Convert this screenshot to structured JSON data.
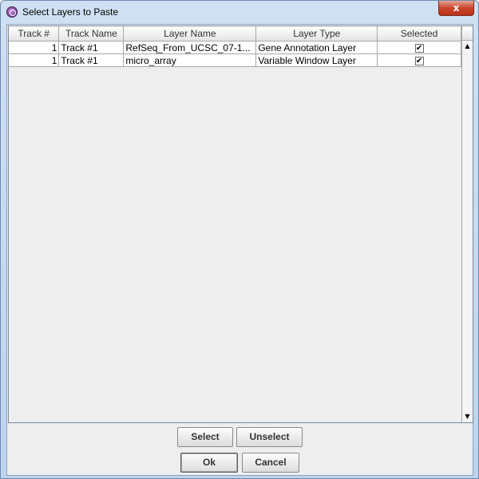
{
  "window": {
    "title": "Select Layers to Paste",
    "close_label": "x"
  },
  "table": {
    "columns": [
      "Track #",
      "Track Name",
      "Layer Name",
      "Layer Type",
      "Selected"
    ],
    "rows": [
      {
        "track_num": "1",
        "track_name": "Track #1",
        "layer_name": "RefSeq_From_UCSC_07-1...",
        "layer_type": "Gene Annotation Layer",
        "selected": "✔"
      },
      {
        "track_num": "1",
        "track_name": "Track #1",
        "layer_name": "micro_array",
        "layer_type": "Variable Window Layer",
        "selected": "✔"
      }
    ]
  },
  "scrollbar": {
    "up_arrow": "▲",
    "down_arrow": "▼"
  },
  "buttons": {
    "select": "Select",
    "unselect": "Unselect",
    "ok": "Ok",
    "cancel": "Cancel"
  },
  "icons": {
    "app": "app-icon",
    "close": "close-icon",
    "check": "check-icon",
    "scroll_up": "arrow-up-icon",
    "scroll_down": "arrow-down-icon"
  }
}
